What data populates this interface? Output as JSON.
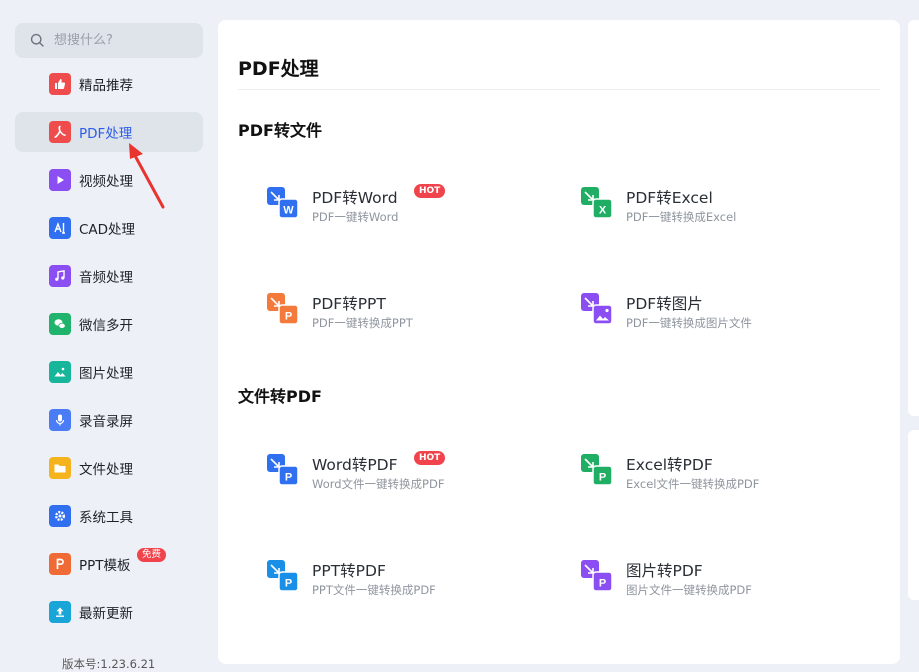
{
  "search": {
    "placeholder": "想搜什么?"
  },
  "sidebar": {
    "items": [
      {
        "label": "精品推荐",
        "icon": "thumbs-up-icon",
        "color": "#ef4d4d"
      },
      {
        "label": "PDF处理",
        "icon": "pdf-icon",
        "color": "#ef4d4d"
      },
      {
        "label": "视频处理",
        "icon": "play-icon",
        "color": "#8a4ef2"
      },
      {
        "label": "CAD处理",
        "icon": "cad-icon",
        "color": "#2f6ff0"
      },
      {
        "label": "音频处理",
        "icon": "music-icon",
        "color": "#8a4ef2"
      },
      {
        "label": "微信多开",
        "icon": "wechat-icon",
        "color": "#1fb36b"
      },
      {
        "label": "图片处理",
        "icon": "image-icon",
        "color": "#17b59a"
      },
      {
        "label": "录音录屏",
        "icon": "microphone-icon",
        "color": "#4a7cf5"
      },
      {
        "label": "文件处理",
        "icon": "folder-icon",
        "color": "#f5b31e"
      },
      {
        "label": "系统工具",
        "icon": "gear-icon",
        "color": "#2f6ff0"
      },
      {
        "label": "PPT模板",
        "icon": "ppt-icon",
        "color": "#f06a35",
        "badge": "免费"
      },
      {
        "label": "最新更新",
        "icon": "upload-icon",
        "color": "#1aa5d8"
      }
    ],
    "version": "版本号:1.23.6.21"
  },
  "main": {
    "title": "PDF处理",
    "sections": [
      {
        "title": "PDF转文件",
        "tools": [
          {
            "name": "PDF转Word",
            "desc": "PDF一键转Word",
            "badge": "HOT",
            "icon": "pdf-to-word-icon",
            "color": "#2f6ff0"
          },
          {
            "name": "PDF转Excel",
            "desc": "PDF一键转换成Excel",
            "icon": "pdf-to-excel-icon",
            "color": "#1fae63"
          },
          {
            "name": "PDF转PPT",
            "desc": "PDF一键转换成PPT",
            "icon": "pdf-to-ppt-icon",
            "color": "#f37a3a"
          },
          {
            "name": "PDF转图片",
            "desc": "PDF一键转换成图片文件",
            "icon": "pdf-to-image-icon",
            "color": "#8a4ef2"
          }
        ]
      },
      {
        "title": "文件转PDF",
        "tools": [
          {
            "name": "Word转PDF",
            "desc": "Word文件一键转换成PDF",
            "badge": "HOT",
            "icon": "word-to-pdf-icon",
            "color": "#2f6ff0"
          },
          {
            "name": "Excel转PDF",
            "desc": "Excel文件一键转换成PDF",
            "icon": "excel-to-pdf-icon",
            "color": "#1fae63"
          },
          {
            "name": "PPT转PDF",
            "desc": "PPT文件一键转换成PDF",
            "icon": "ppt-to-pdf-icon",
            "color": "#1a8fe8"
          },
          {
            "name": "图片转PDF",
            "desc": "图片文件一键转换成PDF",
            "icon": "image-to-pdf-icon",
            "color": "#8a4ef2"
          }
        ]
      }
    ]
  }
}
